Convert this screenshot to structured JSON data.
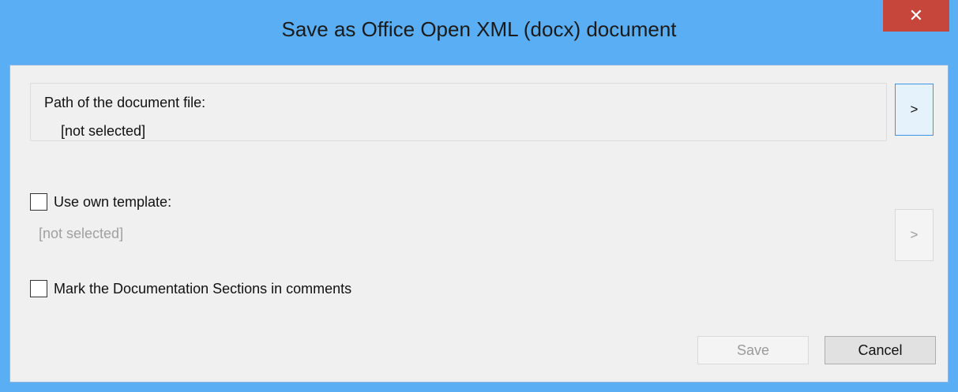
{
  "window": {
    "title": "Save as Office Open XML (docx) document",
    "close_glyph": "✕"
  },
  "path_group": {
    "legend": "Path of the document file:",
    "value": "[not selected]",
    "browse_label": ">"
  },
  "template": {
    "checkbox_label": "Use own template:",
    "checked": false,
    "value": "[not selected]",
    "browse_label": ">"
  },
  "mark_sections": {
    "checkbox_label": "Mark the Documentation Sections in comments",
    "checked": false
  },
  "buttons": {
    "save_label": "Save",
    "cancel_label": "Cancel"
  },
  "colors": {
    "title_bar": "#5aaef3",
    "close_button": "#c7463c",
    "dialog_background": "#f0f0f0"
  }
}
